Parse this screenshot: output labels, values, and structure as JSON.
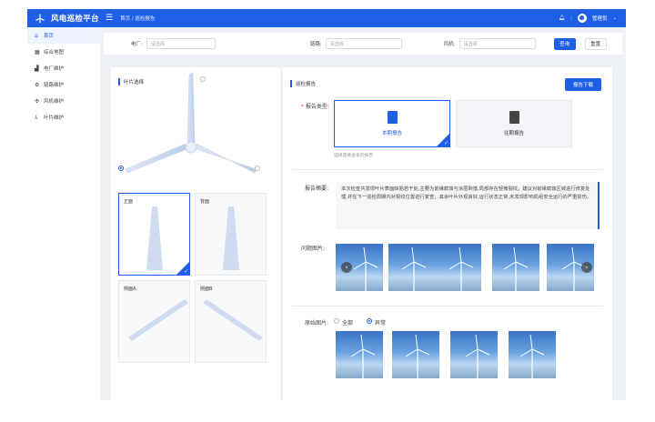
{
  "app": {
    "title": "风电巡检平台",
    "breadcrumb": "首页 / 巡检报告",
    "user": "管理员"
  },
  "sidebar": {
    "items": [
      {
        "label": "首页",
        "icon": "home-icon",
        "active": true
      },
      {
        "label": "综合地图",
        "icon": "map-icon",
        "active": false
      },
      {
        "label": "电厂维护",
        "icon": "plant-icon",
        "active": false
      },
      {
        "label": "链路维护",
        "icon": "link-icon",
        "active": false
      },
      {
        "label": "风机维护",
        "icon": "turbine-icon",
        "active": false
      },
      {
        "label": "叶片维护",
        "icon": "blade-icon",
        "active": false
      }
    ]
  },
  "filter": {
    "plant_label": "电厂:",
    "plant_placeholder": "请选择",
    "link_label": "链路:",
    "link_placeholder": "请选择",
    "turbine_label": "风机:",
    "turbine_placeholder": "请选择",
    "search_label": "查询",
    "reset_label": "重置"
  },
  "left_panel": {
    "title": "叶片选择",
    "views": [
      {
        "label": "正面",
        "selected": true
      },
      {
        "label": "背面",
        "selected": false
      },
      {
        "label": "侧面A",
        "selected": false
      },
      {
        "label": "侧面B",
        "selected": false
      }
    ]
  },
  "right_panel": {
    "title": "巡检报告",
    "download_label": "报告下载",
    "report_type_label": "报告类型:",
    "report_types": [
      {
        "label": "本期报告",
        "selected": true
      },
      {
        "label": "往期报告",
        "selected": false
      }
    ],
    "report_hint": "选择需要查看的报告",
    "summary_label": "报告摘要:",
    "summary_text": "本次检查共发现叶片表面缺陷若干处,主要为前缘腐蚀与涂层剥落,局部存在轻微裂纹。建议对前缘腐蚀区域进行修复处理,并在下一巡检周期内对裂纹位置进行复查。其余叶片外观良好,运行状态正常,未发现影响机组安全运行的严重损伤。",
    "problem_images_label": "问题图片:",
    "original_images_label": "原始图片:",
    "filter_all": "全部",
    "filter_abnormal": "异常",
    "abnormal_selected": true
  }
}
